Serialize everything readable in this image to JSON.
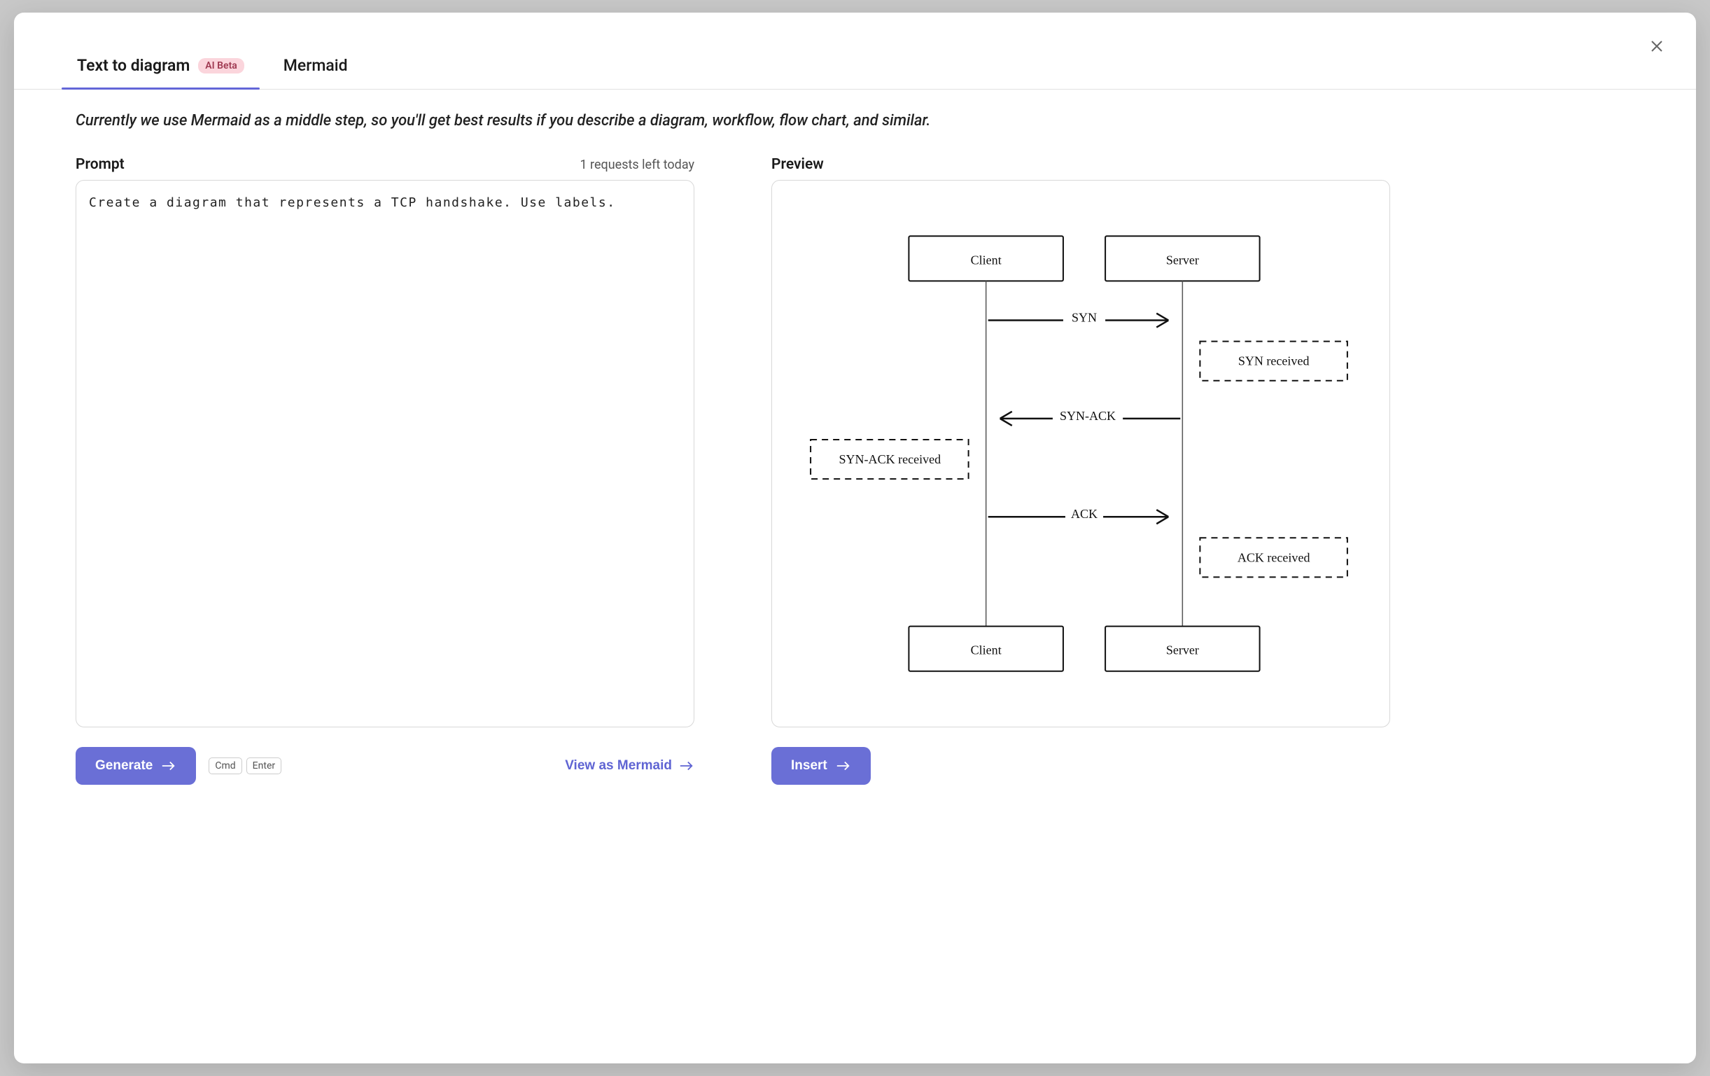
{
  "tabs": {
    "text_to_diagram": "Text to diagram",
    "badge": "AI Beta",
    "mermaid": "Mermaid"
  },
  "helper_text": "Currently we use Mermaid as a middle step, so you'll get best results if you describe a diagram, workflow, flow chart, and similar.",
  "prompt": {
    "title": "Prompt",
    "requests_left": "1 requests left today",
    "value": "Create a diagram that represents a TCP handshake. Use labels."
  },
  "preview": {
    "title": "Preview"
  },
  "buttons": {
    "generate": "Generate",
    "kbd_cmd": "Cmd",
    "kbd_enter": "Enter",
    "view_as_mermaid": "View as Mermaid",
    "insert": "Insert"
  },
  "chart_data": {
    "type": "sequence",
    "participants": [
      "Client",
      "Server"
    ],
    "messages": [
      {
        "from": "Client",
        "to": "Server",
        "label": "SYN"
      },
      {
        "note_on": "Server",
        "note": "SYN received"
      },
      {
        "from": "Server",
        "to": "Client",
        "label": "SYN-ACK"
      },
      {
        "note_on": "Client",
        "note": "SYN-ACK received"
      },
      {
        "from": "Client",
        "to": "Server",
        "label": "ACK"
      },
      {
        "note_on": "Server",
        "note": "ACK received"
      }
    ]
  }
}
